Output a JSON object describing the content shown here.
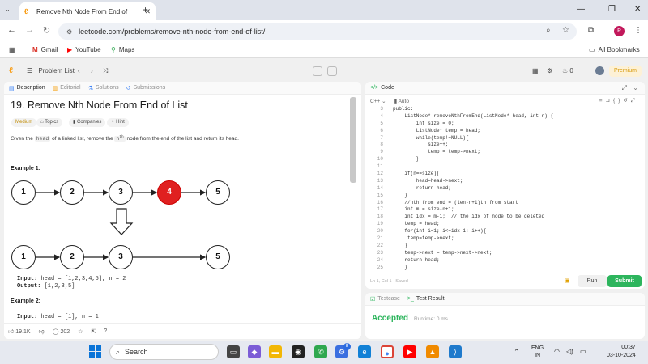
{
  "browser": {
    "tab_title": "Remove Nth Node From End of",
    "url": "leetcode.com/problems/remove-nth-node-from-end-of-list/",
    "bookmarks": [
      {
        "label": "Gmail"
      },
      {
        "label": "YouTube"
      },
      {
        "label": "Maps"
      }
    ],
    "all_bookmarks": "All Bookmarks",
    "profile_initial": "P"
  },
  "leetcode_header": {
    "problem_list": "Problem List",
    "streak": "0",
    "premium": "Premium"
  },
  "left_tabs": [
    "Description",
    "Editorial",
    "Solutions",
    "Submissions"
  ],
  "problem": {
    "title": "19. Remove Nth Node From End of List",
    "difficulty": "Medium",
    "chips": [
      "Topics",
      "Companies",
      "Hint"
    ],
    "desc_part1": "Given the",
    "desc_code1": "head",
    "desc_part2": "of a linked list, remove the",
    "desc_code2": "n",
    "desc_sup": "th",
    "desc_part3": "node from the end of the list and return its head.",
    "example1_heading": "Example 1:",
    "example1_before": [
      "1",
      "2",
      "3",
      "4",
      "5"
    ],
    "example1_after": [
      "1",
      "2",
      "3",
      "5"
    ],
    "example1_input_label": "Input:",
    "example1_input": "head = [1,2,3,4,5], n = 2",
    "example1_output_label": "Output:",
    "example1_output": "[1,2,3,5]",
    "example2_heading": "Example 2:",
    "example2_input_label": "Input:",
    "example2_input": "head = [1], n = 1"
  },
  "left_footer": {
    "likes": "19.1K",
    "comments": "202"
  },
  "code_panel": {
    "tab": "Code",
    "language": "C++",
    "auto": "Auto",
    "cursor": "Ln 1, Col 1",
    "saved": "Saved",
    "run": "Run",
    "submit": "Submit",
    "lines": [
      {
        "n": "3",
        "t": "public:"
      },
      {
        "n": "4",
        "t": "    ListNode* removeNthFromEnd(ListNode* head, int n) {"
      },
      {
        "n": "5",
        "t": "        int size = 0;"
      },
      {
        "n": "6",
        "t": "        ListNode* temp = head;"
      },
      {
        "n": "7",
        "t": "        while(temp!=NULL){"
      },
      {
        "n": "8",
        "t": "            size++;"
      },
      {
        "n": "9",
        "t": "            temp = temp->next;"
      },
      {
        "n": "10",
        "t": "        }"
      },
      {
        "n": "11",
        "t": ""
      },
      {
        "n": "12",
        "t": "    if(n==size){"
      },
      {
        "n": "13",
        "t": "        head=head->next;"
      },
      {
        "n": "14",
        "t": "        return head;"
      },
      {
        "n": "15",
        "t": "    }"
      },
      {
        "n": "16",
        "t": "    //nth from end = (len-n+1)th from start"
      },
      {
        "n": "17",
        "t": "    int m = size-n+1;"
      },
      {
        "n": "18",
        "t": "    int idx = m-1;  // the idx of node to be deleted"
      },
      {
        "n": "19",
        "t": "    temp = head;"
      },
      {
        "n": "20",
        "t": "    for(int i=1; i<=idx-1; i++){"
      },
      {
        "n": "21",
        "t": "     temp=temp->next;"
      },
      {
        "n": "22",
        "t": "    }"
      },
      {
        "n": "23",
        "t": "    temp->next = temp->next->next;"
      },
      {
        "n": "24",
        "t": "    return head;"
      },
      {
        "n": "25",
        "t": "    }"
      }
    ]
  },
  "result_panel": {
    "tab_testcase": "Testcase",
    "tab_result": "Test Result",
    "status": "Accepted",
    "runtime": "Runtime: 0 ms"
  },
  "taskbar": {
    "search": "Search",
    "lang_top": "ENG",
    "lang_bottom": "IN",
    "time": "00:37",
    "date": "03-10-2024",
    "badge": "8"
  },
  "colors": {
    "accent_orange": "#f89f1b",
    "accepted_green": "#2db55d",
    "removed_node_red": "#e02020"
  }
}
